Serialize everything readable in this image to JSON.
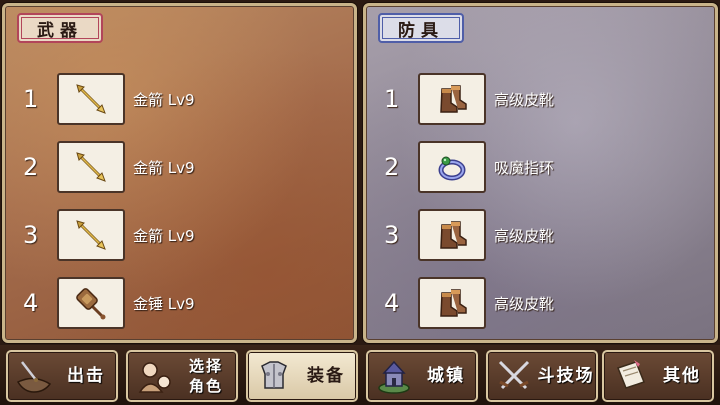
{
  "weapons": {
    "tab_label": "武器",
    "items": [
      {
        "num": "1",
        "label": "金箭 Lv9",
        "icon": "arrow-icon"
      },
      {
        "num": "2",
        "label": "金箭 Lv9",
        "icon": "arrow-icon"
      },
      {
        "num": "3",
        "label": "金箭 Lv9",
        "icon": "arrow-icon"
      },
      {
        "num": "4",
        "label": "金锤 Lv9",
        "icon": "hammer-icon"
      }
    ]
  },
  "armor": {
    "tab_label": "防具",
    "items": [
      {
        "num": "1",
        "label": "高级皮靴",
        "icon": "boots-icon"
      },
      {
        "num": "2",
        "label": "吸魔指环",
        "icon": "ring-icon"
      },
      {
        "num": "3",
        "label": "高级皮靴",
        "icon": "boots-icon"
      },
      {
        "num": "4",
        "label": "高级皮靴",
        "icon": "boots-icon"
      }
    ]
  },
  "menu": {
    "sortie": "出击",
    "select_line1": "选择",
    "select_line2": "角色",
    "equip": "装备",
    "town": "城镇",
    "arena": "斗技场",
    "other": "其他"
  },
  "colors": {
    "weapons_tab_border": "#b2455a",
    "armor_tab_border": "#4f5ea8",
    "active_button": "#f3e9d2"
  }
}
